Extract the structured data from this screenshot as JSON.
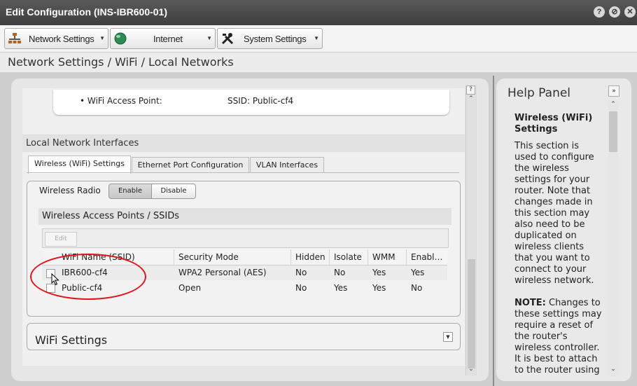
{
  "window": {
    "title": "Edit Configuration (INS-IBR600-01)"
  },
  "toolbar": {
    "network_settings": "Network Settings",
    "internet": "Internet",
    "system_settings": "System Settings"
  },
  "breadcrumb": "Network Settings / WiFi / Local Networks",
  "summary": {
    "label": "WiFi Access Point:",
    "value": "SSID: Public-cf4"
  },
  "local_network": {
    "section_title": "Local Network Interfaces",
    "tabs": [
      "Wireless (WiFi) Settings",
      "Ethernet Port Configuration",
      "VLAN Interfaces"
    ],
    "active_tab": 0
  },
  "wireless_radio": {
    "label": "Wireless Radio",
    "enable": "Enable",
    "disable": "Disable",
    "selected": "Enable"
  },
  "access_points": {
    "title": "Wireless Access Points / SSIDs",
    "edit_label": "Edit",
    "columns": [
      "WiFi Name (SSID)",
      "Security Mode",
      "Hidden",
      "Isolate",
      "WMM",
      "Enabl…"
    ],
    "rows": [
      [
        "IBR600-cf4",
        "WPA2 Personal (AES)",
        "No",
        "No",
        "Yes",
        "Yes"
      ],
      [
        "Public-cf4",
        "Open",
        "No",
        "Yes",
        "Yes",
        "No"
      ]
    ]
  },
  "wifi_settings": {
    "title": "WiFi Settings"
  },
  "help": {
    "title": "Help Panel",
    "heading": "Wireless (WiFi) Settings",
    "paragraph1": "This section is used to configure the wireless settings for your router. Note that changes made in this section may also need to be duplicated on wireless clients that you want to connect to your wireless network.",
    "note_label": "NOTE:",
    "paragraph2": " Changes to these settings may require a reset of the router's wireless controller. It is best to attach to the router using"
  },
  "colors": {
    "annotation": "#e0141b",
    "titlebar": "#4a4a4a"
  }
}
